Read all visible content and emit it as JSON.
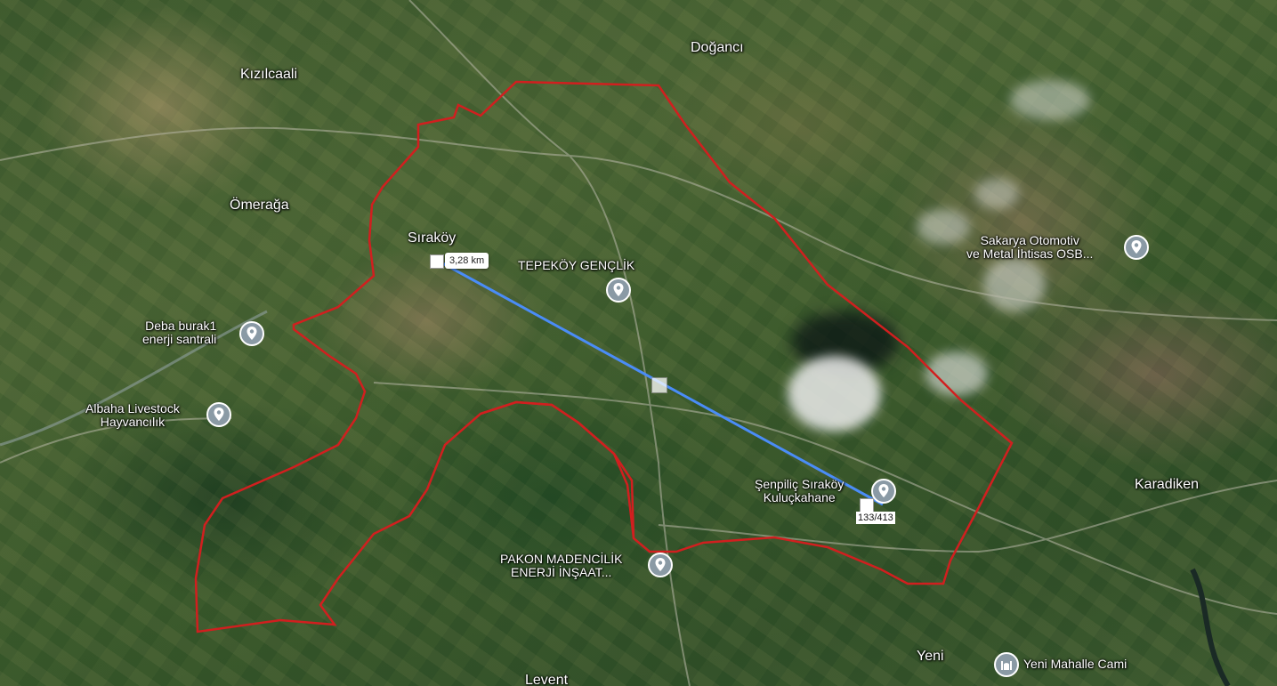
{
  "map": {
    "places": [
      {
        "name": "Doğancı"
      },
      {
        "name": "Kızılcaali"
      },
      {
        "name": "Ömerağa"
      },
      {
        "name": "Sıraköy"
      },
      {
        "name": "Karadiken"
      },
      {
        "name": "Yeni"
      },
      {
        "name": "Levent"
      }
    ],
    "pois": [
      {
        "line1": "TEPEKÖY GENÇLİK",
        "line2": ""
      },
      {
        "line1": "Sakarya Otomotiv",
        "line2": "ve Metal İhtisas OSB..."
      },
      {
        "line1": "Deba burak1",
        "line2": "enerji santrali"
      },
      {
        "line1": "Albaha Livestock",
        "line2": "Hayvancılık"
      },
      {
        "line1": "Şenpiliç Sıraköy",
        "line2": "Kuluçkahane"
      },
      {
        "line1": "PAKON MADENCİLİK",
        "line2": "ENERJİ İNŞAAT..."
      },
      {
        "line1": "Yeni Mahalle Cami",
        "line2": ""
      }
    ],
    "measurement": {
      "distance": "3,28 km",
      "counter": "133/413"
    },
    "colors": {
      "boundary": "#d11f1f",
      "measure_line": "#4a8cf7"
    }
  }
}
